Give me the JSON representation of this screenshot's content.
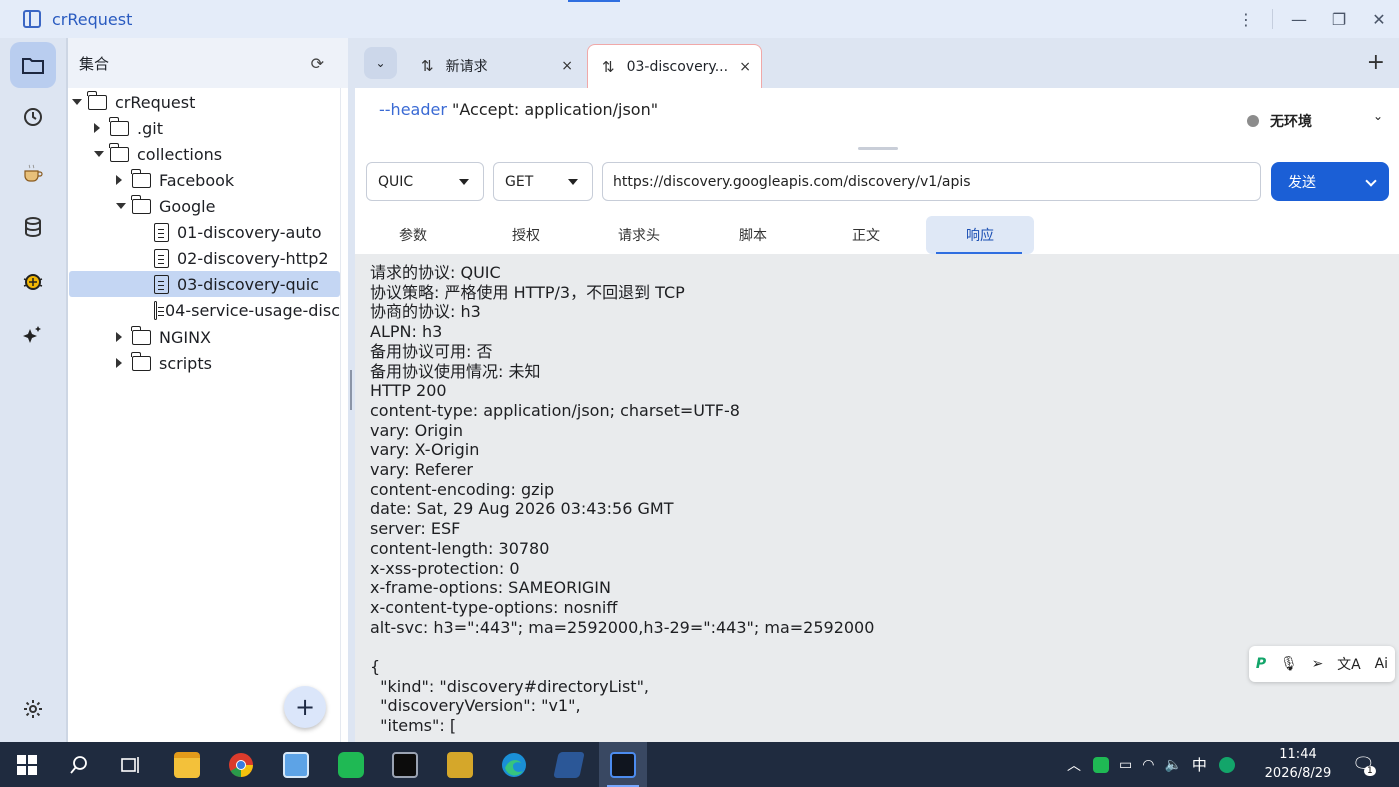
{
  "app": {
    "title": "crRequest"
  },
  "collections": {
    "header": "集合",
    "tree": [
      {
        "label": "crRequest",
        "type": "folder",
        "expanded": true,
        "depth": 0
      },
      {
        "label": ".git",
        "type": "folder",
        "expanded": false,
        "depth": 1
      },
      {
        "label": "collections",
        "type": "folder",
        "expanded": true,
        "depth": 1
      },
      {
        "label": "Facebook",
        "type": "folder",
        "expanded": false,
        "depth": 2
      },
      {
        "label": "Google",
        "type": "folder",
        "expanded": true,
        "depth": 2
      },
      {
        "label": "01-discovery-auto",
        "type": "file",
        "depth": 3
      },
      {
        "label": "02-discovery-http2",
        "type": "file",
        "depth": 3
      },
      {
        "label": "03-discovery-quic",
        "type": "file",
        "depth": 3,
        "selected": true
      },
      {
        "label": "04-service-usage-disc",
        "type": "file",
        "depth": 3
      },
      {
        "label": "NGINX",
        "type": "folder",
        "expanded": false,
        "depth": 2
      },
      {
        "label": "scripts",
        "type": "folder",
        "expanded": false,
        "depth": 2
      }
    ],
    "add_label": "+"
  },
  "tabs": [
    {
      "label": "新请求",
      "close": "×"
    },
    {
      "label": "03-discovery...",
      "close": "×",
      "active": true
    }
  ],
  "tab_add": "+",
  "curl": {
    "flag": "--header",
    "value": " \"Accept: application/json\""
  },
  "env": {
    "label": "无环境"
  },
  "request": {
    "protocol": "QUIC",
    "method": "GET",
    "url": "https://discovery.googleapis.com/discovery/v1/apis",
    "send_label": "发送"
  },
  "subtabs": [
    "参数",
    "授权",
    "请求头",
    "脚本",
    "正文",
    "响应"
  ],
  "response_lines": [
    "请求的协议: QUIC",
    "协议策略: 严格使用 HTTP/3，不回退到 TCP",
    "协商的协议: h3",
    "ALPN: h3",
    "备用协议可用: 否",
    "备用协议使用情况: 未知",
    "HTTP 200",
    "content-type: application/json; charset=UTF-8",
    "vary: Origin",
    "vary: X-Origin",
    "vary: Referer",
    "content-encoding: gzip",
    "date: Sat, 29 Aug 2026 03:43:56 GMT",
    "server: ESF",
    "content-length: 30780",
    "x-xss-protection: 0",
    "x-frame-options: SAMEORIGIN",
    "x-content-type-options: nosniff",
    "alt-svc: h3=\":443\"; ma=2592000,h3-29=\":443\"; ma=2592000",
    "",
    "{",
    "  \"kind\": \"discovery#directoryList\",",
    "  \"discoveryVersion\": \"v1\",",
    "  \"items\": ["
  ],
  "floatbar": {
    "translate": "文A",
    "ai": "Ai"
  },
  "taskbar": {
    "time": "11:44",
    "date": "2026/8/29",
    "ime": "中",
    "notif_count": "1"
  },
  "colors": {
    "accent": "#1b5fd6",
    "selected_row": "#c4d6f3",
    "response_bg": "#e9ebed"
  }
}
